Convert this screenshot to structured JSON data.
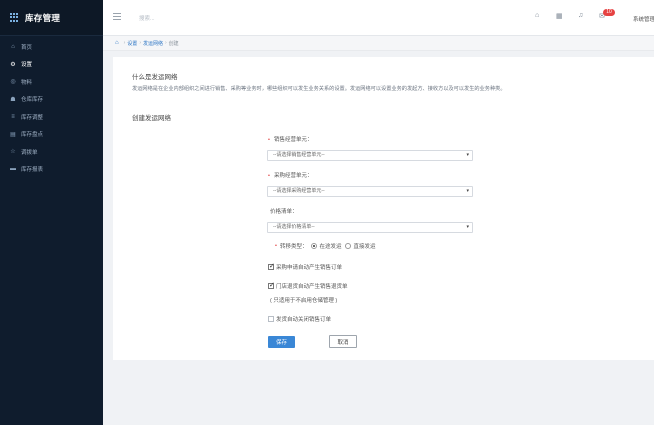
{
  "app": {
    "title": "库存管理"
  },
  "sidebar": {
    "items": [
      {
        "label": "首页",
        "icon": "home-icon",
        "glyph": "⌂"
      },
      {
        "label": "设置",
        "icon": "gear-icon",
        "glyph": "⚙",
        "active": true
      },
      {
        "label": "物料",
        "icon": "box-icon",
        "glyph": "◎"
      },
      {
        "label": "仓库库存",
        "icon": "warehouse-icon",
        "glyph": "☗"
      },
      {
        "label": "库存调整",
        "icon": "adjust-icon",
        "glyph": "≡"
      },
      {
        "label": "库存盘点",
        "icon": "clipboard-icon",
        "glyph": "▤"
      },
      {
        "label": "调拨单",
        "icon": "star-icon",
        "glyph": "☆"
      },
      {
        "label": "库存报表",
        "icon": "report-icon",
        "glyph": "▬"
      }
    ]
  },
  "header": {
    "search_placeholder": "搜索...",
    "badge_count": "10",
    "user_name": "系统管理"
  },
  "breadcrumb": {
    "items": [
      "设置",
      "发运网络",
      "创建"
    ]
  },
  "intro": {
    "title": "什么是发运网络",
    "description": "发运网络是在企业内部组织之间进行销售、采购等业务时，哪些组织可以发生业务关系的设置。发运网络可以设置业务的发起方、接收方以及可以发生的业务种类。"
  },
  "form": {
    "section_title": "创建发运网络",
    "sales_unit": {
      "label": "销售经营单元：",
      "placeholder": "--请选择销售经营单元--"
    },
    "purchase_unit": {
      "label": "采购经营单元：",
      "placeholder": "--请选择采购经营单元--"
    },
    "price_list": {
      "label": "价格清单：",
      "placeholder": "--请选择价格清单--"
    },
    "transfer_type": {
      "label": "转移类型：",
      "options": [
        "在途发运",
        "直接发运"
      ],
      "selected": "在途发运"
    },
    "checks": {
      "auto_sales_order": "采购申请自动产生销售订单",
      "auto_return_order": "门店退货自动产生销售退货单",
      "auto_close_order": "发货自动关闭销售订单"
    },
    "note": "( 只适用于不启用仓储管理 )",
    "save_label": "保存",
    "cancel_label": "取消"
  },
  "colors": {
    "sidebar_bg": "#0f1c2d",
    "primary": "#3a87d6",
    "badge": "#e64242",
    "required": "#e03b3b"
  }
}
